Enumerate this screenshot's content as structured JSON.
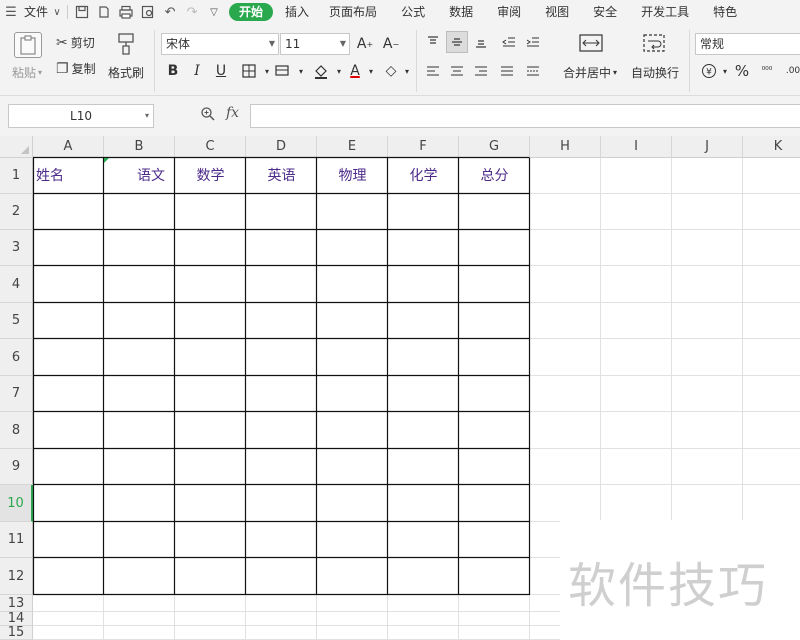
{
  "menubar": {
    "file_label": "文件",
    "tabs": [
      {
        "label": "开始",
        "active": true
      },
      {
        "label": "插入"
      },
      {
        "label": "页面布局"
      },
      {
        "label": "公式"
      },
      {
        "label": "数据"
      },
      {
        "label": "审阅"
      },
      {
        "label": "视图"
      },
      {
        "label": "安全"
      },
      {
        "label": "开发工具"
      },
      {
        "label": "特色"
      }
    ]
  },
  "ribbon": {
    "paste_label": "粘贴",
    "cut_label": "剪切",
    "copy_label": "复制",
    "format_painter_label": "格式刷",
    "font_name": "宋体",
    "font_size": "11",
    "merge_center_label": "合并居中",
    "wrap_text_label": "自动换行",
    "number_format": "常规",
    "percent_symbol": "%"
  },
  "formulabar": {
    "name_box": "L10",
    "fx_label": "fx"
  },
  "sheet": {
    "columns": [
      "A",
      "B",
      "C",
      "D",
      "E",
      "F",
      "G",
      "H",
      "I",
      "J",
      "K"
    ],
    "rows": [
      "1",
      "2",
      "3",
      "4",
      "5",
      "6",
      "7",
      "8",
      "9",
      "10",
      "11",
      "12",
      "13",
      "14",
      "15"
    ],
    "active_row": "10",
    "header_cells": [
      "姓名",
      "语文",
      "数学",
      "英语",
      "物理",
      "化学",
      "总分"
    ]
  },
  "watermark": "软件技巧",
  "colors": {
    "accent": "#2aa84d",
    "header_text": "#4b2a8a"
  }
}
